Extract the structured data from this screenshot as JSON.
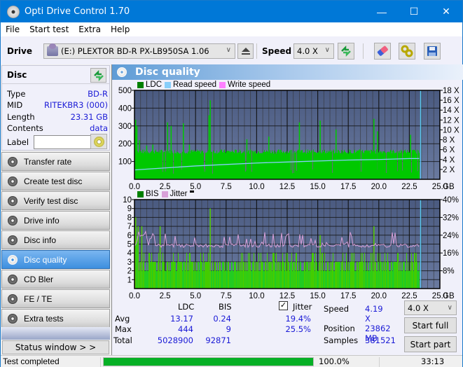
{
  "window": {
    "title": "Opti Drive Control 1.70",
    "controls": {
      "minimize": "—",
      "maximize": "☐",
      "close": "✕"
    }
  },
  "menu": [
    "File",
    "Start test",
    "Extra",
    "Help"
  ],
  "toolbar": {
    "drive_label": "Drive",
    "drive_value": "(E:)  PLEXTOR BD-R  PX-LB950SA 1.06",
    "speed_label": "Speed",
    "speed_value": "4.0 X",
    "icons": [
      "eject-icon",
      "refresh-icon",
      "erase-icon",
      "settings-icon",
      "save-icon"
    ]
  },
  "disc": {
    "title": "Disc",
    "fields": [
      {
        "key": "Type",
        "value": "BD-R"
      },
      {
        "key": "MID",
        "value": "RITEKBR3 (000)"
      },
      {
        "key": "Length",
        "value": "23.31 GB"
      },
      {
        "key": "Contents",
        "value": "data"
      }
    ],
    "label_key": "Label",
    "label_value": ""
  },
  "nav": [
    {
      "label": "Transfer rate",
      "active": false
    },
    {
      "label": "Create test disc",
      "active": false
    },
    {
      "label": "Verify test disc",
      "active": false
    },
    {
      "label": "Drive info",
      "active": false
    },
    {
      "label": "Disc info",
      "active": false
    },
    {
      "label": "Disc quality",
      "active": true
    },
    {
      "label": "CD Bler",
      "active": false
    },
    {
      "label": "FE / TE",
      "active": false
    },
    {
      "label": "Extra tests",
      "active": false
    }
  ],
  "status_window_label": "Status window > >",
  "panel_title": "Disc quality",
  "colors": {
    "ldc": "#008000",
    "read_speed": "#87cefa",
    "write_speed": "#ff80ff",
    "bis": "#008000",
    "jitter": "#d8a0d8",
    "bar_green": "#00c800",
    "plot_bg_top": "#4a5a80",
    "plot_bg_bottom": "#6a7aa0",
    "accent": "#0078d7"
  },
  "chart_data": [
    {
      "type": "bar",
      "title": "LDC / Read speed",
      "legend": [
        "LDC",
        "Read speed",
        "Write speed"
      ],
      "x_ticks": [
        "0.0",
        "2.5",
        "5.0",
        "7.5",
        "10.0",
        "12.5",
        "15.0",
        "17.5",
        "20.0",
        "22.5",
        "25.0"
      ],
      "x_unit": "GB",
      "xlim": [
        0,
        25
      ],
      "y_left_ticks": [
        "100",
        "200",
        "300",
        "400",
        "500"
      ],
      "ylim_left": [
        0,
        500
      ],
      "y_right_ticks": [
        "2 X",
        "4 X",
        "6 X",
        "8 X",
        "10 X",
        "12 X",
        "14 X",
        "16 X",
        "18 X"
      ],
      "ylim_right": [
        0,
        18
      ],
      "disc_end_gb": 23.31,
      "ldc_baseline": 160,
      "ldc_spikes": [
        [
          0.1,
          335
        ],
        [
          0.2,
          300
        ],
        [
          0.4,
          220
        ],
        [
          1.0,
          190
        ],
        [
          1.5,
          195
        ],
        [
          2.7,
          320
        ],
        [
          3.0,
          300
        ],
        [
          4.0,
          315
        ],
        [
          4.5,
          195
        ],
        [
          6.2,
          444
        ],
        [
          6.1,
          360
        ],
        [
          9.2,
          225
        ],
        [
          11.0,
          240
        ],
        [
          13.5,
          320
        ],
        [
          15.2,
          330
        ],
        [
          16.5,
          280
        ],
        [
          19.6,
          340
        ],
        [
          19.9,
          270
        ],
        [
          22.6,
          250
        ]
      ],
      "read_speed": [
        [
          0,
          1.9
        ],
        [
          2.5,
          2.3
        ],
        [
          5.0,
          2.7
        ],
        [
          7.5,
          3.0
        ],
        [
          10.0,
          3.3
        ],
        [
          12.5,
          3.5
        ],
        [
          15.0,
          3.7
        ],
        [
          17.5,
          3.9
        ],
        [
          20.0,
          4.0
        ],
        [
          22.5,
          4.2
        ],
        [
          23.31,
          4.2
        ]
      ]
    },
    {
      "type": "bar",
      "title": "BIS / Jitter",
      "legend": [
        "BIS",
        "Jitter"
      ],
      "x_ticks": [
        "0.0",
        "2.5",
        "5.0",
        "7.5",
        "10.0",
        "12.5",
        "15.0",
        "17.5",
        "20.0",
        "22.5",
        "25.0"
      ],
      "x_unit": "GB",
      "xlim": [
        0,
        25
      ],
      "y_left_ticks": [
        "1",
        "2",
        "3",
        "4",
        "5",
        "6",
        "7",
        "8",
        "9",
        "10"
      ],
      "ylim_left": [
        0,
        10
      ],
      "y_right_ticks": [
        "8%",
        "16%",
        "24%",
        "32%",
        "40%"
      ],
      "ylim_right": [
        0,
        40
      ],
      "disc_end_gb": 23.31,
      "bis_baseline": 3,
      "bis_spikes": [
        [
          0.1,
          8
        ],
        [
          0.3,
          7
        ],
        [
          0.6,
          7
        ],
        [
          2.1,
          7
        ],
        [
          6.2,
          9
        ],
        [
          19.6,
          7
        ],
        [
          15.2,
          6
        ]
      ],
      "jitter_base_pct": 18.5,
      "jitter_peak_pct": 25.5
    }
  ],
  "stats": {
    "headers": [
      "LDC",
      "BIS"
    ],
    "rows": [
      {
        "label": "Avg",
        "ldc": "13.17",
        "bis": "0.24",
        "jitter": "19.4%"
      },
      {
        "label": "Max",
        "ldc": "444",
        "bis": "9",
        "jitter": "25.5%"
      },
      {
        "label": "Total",
        "ldc": "5028900",
        "bis": "92871",
        "jitter": ""
      }
    ],
    "jitter_label": "Jitter",
    "jitter_checked": true,
    "speed_label": "Speed",
    "speed_value": "4.19 X",
    "position_label": "Position",
    "position_value": "23862 MB",
    "samples_label": "Samples",
    "samples_value": "381521",
    "speed_select": "4.0 X",
    "start_full": "Start full",
    "start_part": "Start part"
  },
  "statusbar": {
    "text": "Test completed",
    "progress": 100.0,
    "progress_label": "100.0%",
    "time": "33:13"
  }
}
